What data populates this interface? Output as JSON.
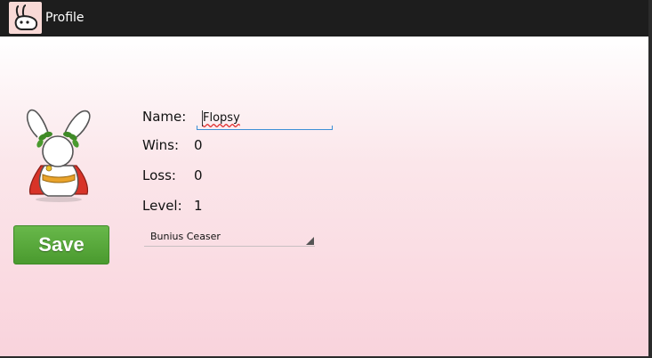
{
  "action_bar": {
    "title": "Profile",
    "icon": "bunny-app-icon"
  },
  "profile": {
    "avatar_icon": "bunny-caesar-avatar",
    "name_label": "Name:",
    "name_value": "Flopsy",
    "wins_label": "Wins:",
    "wins_value": "0",
    "loss_label": "Loss:",
    "loss_value": "0",
    "level_label": "Level:",
    "level_value": "1",
    "character_selected": "Bunius Ceaser",
    "save_label": "Save"
  },
  "colors": {
    "action_bar_bg": "#1d1d1d",
    "save_button": "#5aab3c",
    "field_underline": "#3d8fd6",
    "background_pink": "#f9d3dc"
  }
}
